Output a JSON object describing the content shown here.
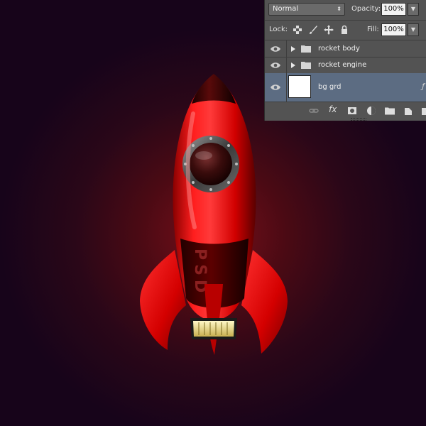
{
  "canvas": {
    "background_colors": [
      "#7a0f19",
      "#17041a"
    ],
    "rocket_text": "PSD",
    "rocket_color": "#ff1a1a"
  },
  "layers_panel": {
    "blend_mode": "Normal",
    "opacity_label": "Opacity:",
    "opacity_value": "100%",
    "lock_label": "Lock:",
    "fill_label": "Fill:",
    "fill_value": "100%",
    "layers": [
      {
        "name": "rocket body",
        "type": "group",
        "visible": true,
        "selected": false
      },
      {
        "name": "rocket engine",
        "type": "group",
        "visible": true,
        "selected": false
      },
      {
        "name": "bg grd",
        "type": "layer",
        "visible": true,
        "selected": true,
        "has_effect": true
      }
    ],
    "selected_color": "#5c6c82",
    "footer_icons": [
      "link-icon",
      "fx-icon",
      "mask-icon",
      "adjustment-icon",
      "folder-icon",
      "new-layer-icon",
      "trash-icon"
    ]
  }
}
